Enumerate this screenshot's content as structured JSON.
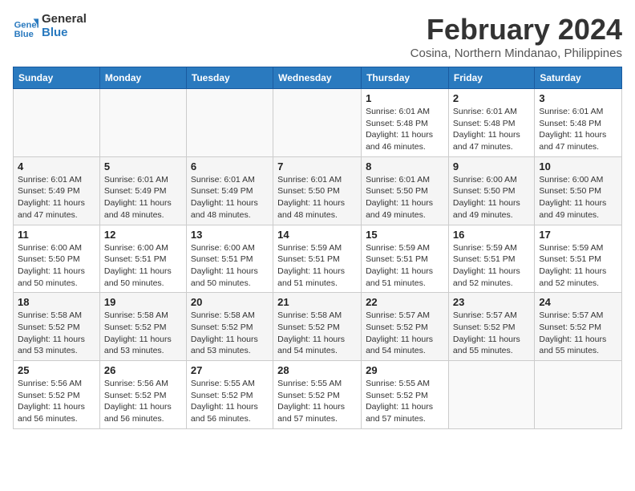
{
  "logo": {
    "line1": "General",
    "line2": "Blue"
  },
  "title": {
    "month_year": "February 2024",
    "location": "Cosina, Northern Mindanao, Philippines"
  },
  "weekdays": [
    "Sunday",
    "Monday",
    "Tuesday",
    "Wednesday",
    "Thursday",
    "Friday",
    "Saturday"
  ],
  "weeks": [
    [
      {
        "day": "",
        "info": ""
      },
      {
        "day": "",
        "info": ""
      },
      {
        "day": "",
        "info": ""
      },
      {
        "day": "",
        "info": ""
      },
      {
        "day": "1",
        "info": "Sunrise: 6:01 AM\nSunset: 5:48 PM\nDaylight: 11 hours and 46 minutes."
      },
      {
        "day": "2",
        "info": "Sunrise: 6:01 AM\nSunset: 5:48 PM\nDaylight: 11 hours and 47 minutes."
      },
      {
        "day": "3",
        "info": "Sunrise: 6:01 AM\nSunset: 5:48 PM\nDaylight: 11 hours and 47 minutes."
      }
    ],
    [
      {
        "day": "4",
        "info": "Sunrise: 6:01 AM\nSunset: 5:49 PM\nDaylight: 11 hours and 47 minutes."
      },
      {
        "day": "5",
        "info": "Sunrise: 6:01 AM\nSunset: 5:49 PM\nDaylight: 11 hours and 48 minutes."
      },
      {
        "day": "6",
        "info": "Sunrise: 6:01 AM\nSunset: 5:49 PM\nDaylight: 11 hours and 48 minutes."
      },
      {
        "day": "7",
        "info": "Sunrise: 6:01 AM\nSunset: 5:50 PM\nDaylight: 11 hours and 48 minutes."
      },
      {
        "day": "8",
        "info": "Sunrise: 6:01 AM\nSunset: 5:50 PM\nDaylight: 11 hours and 49 minutes."
      },
      {
        "day": "9",
        "info": "Sunrise: 6:00 AM\nSunset: 5:50 PM\nDaylight: 11 hours and 49 minutes."
      },
      {
        "day": "10",
        "info": "Sunrise: 6:00 AM\nSunset: 5:50 PM\nDaylight: 11 hours and 49 minutes."
      }
    ],
    [
      {
        "day": "11",
        "info": "Sunrise: 6:00 AM\nSunset: 5:50 PM\nDaylight: 11 hours and 50 minutes."
      },
      {
        "day": "12",
        "info": "Sunrise: 6:00 AM\nSunset: 5:51 PM\nDaylight: 11 hours and 50 minutes."
      },
      {
        "day": "13",
        "info": "Sunrise: 6:00 AM\nSunset: 5:51 PM\nDaylight: 11 hours and 50 minutes."
      },
      {
        "day": "14",
        "info": "Sunrise: 5:59 AM\nSunset: 5:51 PM\nDaylight: 11 hours and 51 minutes."
      },
      {
        "day": "15",
        "info": "Sunrise: 5:59 AM\nSunset: 5:51 PM\nDaylight: 11 hours and 51 minutes."
      },
      {
        "day": "16",
        "info": "Sunrise: 5:59 AM\nSunset: 5:51 PM\nDaylight: 11 hours and 52 minutes."
      },
      {
        "day": "17",
        "info": "Sunrise: 5:59 AM\nSunset: 5:51 PM\nDaylight: 11 hours and 52 minutes."
      }
    ],
    [
      {
        "day": "18",
        "info": "Sunrise: 5:58 AM\nSunset: 5:52 PM\nDaylight: 11 hours and 53 minutes."
      },
      {
        "day": "19",
        "info": "Sunrise: 5:58 AM\nSunset: 5:52 PM\nDaylight: 11 hours and 53 minutes."
      },
      {
        "day": "20",
        "info": "Sunrise: 5:58 AM\nSunset: 5:52 PM\nDaylight: 11 hours and 53 minutes."
      },
      {
        "day": "21",
        "info": "Sunrise: 5:58 AM\nSunset: 5:52 PM\nDaylight: 11 hours and 54 minutes."
      },
      {
        "day": "22",
        "info": "Sunrise: 5:57 AM\nSunset: 5:52 PM\nDaylight: 11 hours and 54 minutes."
      },
      {
        "day": "23",
        "info": "Sunrise: 5:57 AM\nSunset: 5:52 PM\nDaylight: 11 hours and 55 minutes."
      },
      {
        "day": "24",
        "info": "Sunrise: 5:57 AM\nSunset: 5:52 PM\nDaylight: 11 hours and 55 minutes."
      }
    ],
    [
      {
        "day": "25",
        "info": "Sunrise: 5:56 AM\nSunset: 5:52 PM\nDaylight: 11 hours and 56 minutes."
      },
      {
        "day": "26",
        "info": "Sunrise: 5:56 AM\nSunset: 5:52 PM\nDaylight: 11 hours and 56 minutes."
      },
      {
        "day": "27",
        "info": "Sunrise: 5:55 AM\nSunset: 5:52 PM\nDaylight: 11 hours and 56 minutes."
      },
      {
        "day": "28",
        "info": "Sunrise: 5:55 AM\nSunset: 5:52 PM\nDaylight: 11 hours and 57 minutes."
      },
      {
        "day": "29",
        "info": "Sunrise: 5:55 AM\nSunset: 5:52 PM\nDaylight: 11 hours and 57 minutes."
      },
      {
        "day": "",
        "info": ""
      },
      {
        "day": "",
        "info": ""
      }
    ]
  ]
}
